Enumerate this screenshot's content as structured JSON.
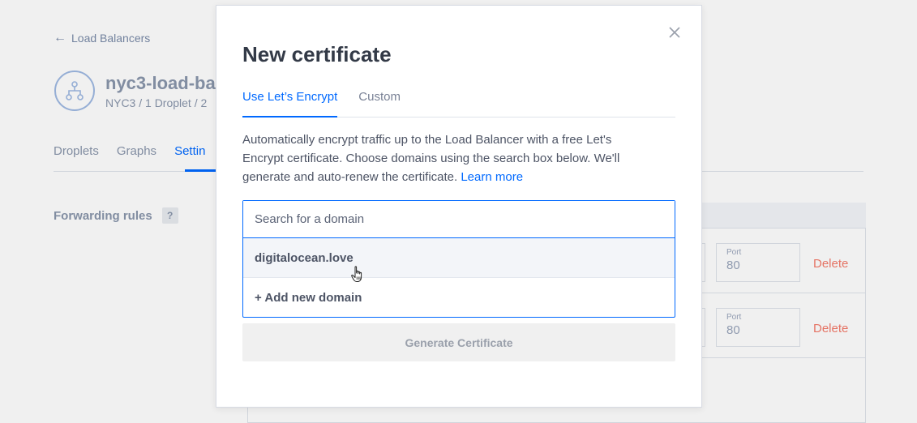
{
  "background": {
    "back_link": "Load Balancers",
    "lb_name": "nyc3-load-ba",
    "lb_meta": "NYC3 / 1 Droplet / 2",
    "tabs": [
      "Droplets",
      "Graphs",
      "Settin"
    ],
    "forwarding_label": "Forwarding rules",
    "help_badge": "?",
    "rules": [
      {
        "port_label": "Port",
        "port_value": "80",
        "delete_label": "Delete"
      },
      {
        "port_label": "Port",
        "port_value": "80",
        "delete_label": "Delete"
      }
    ]
  },
  "modal": {
    "title": "New certificate",
    "tabs": [
      {
        "label": "Use Let’s Encrypt",
        "active": true
      },
      {
        "label": "Custom",
        "active": false
      }
    ],
    "description": "Automatically encrypt traffic up to the Load Balancer with a free Let's Encrypt certificate. Choose domains using the search box below. We'll generate and auto-renew the certificate.",
    "learn_more": "Learn more",
    "search": {
      "placeholder": "Search for a domain",
      "value": ""
    },
    "dropdown": [
      {
        "label": "digitalocean.love",
        "hovered": true
      },
      {
        "label": "+ Add new domain",
        "hovered": false
      }
    ],
    "generate_button": "Generate Certificate",
    "accent_color": "#0069ff"
  }
}
